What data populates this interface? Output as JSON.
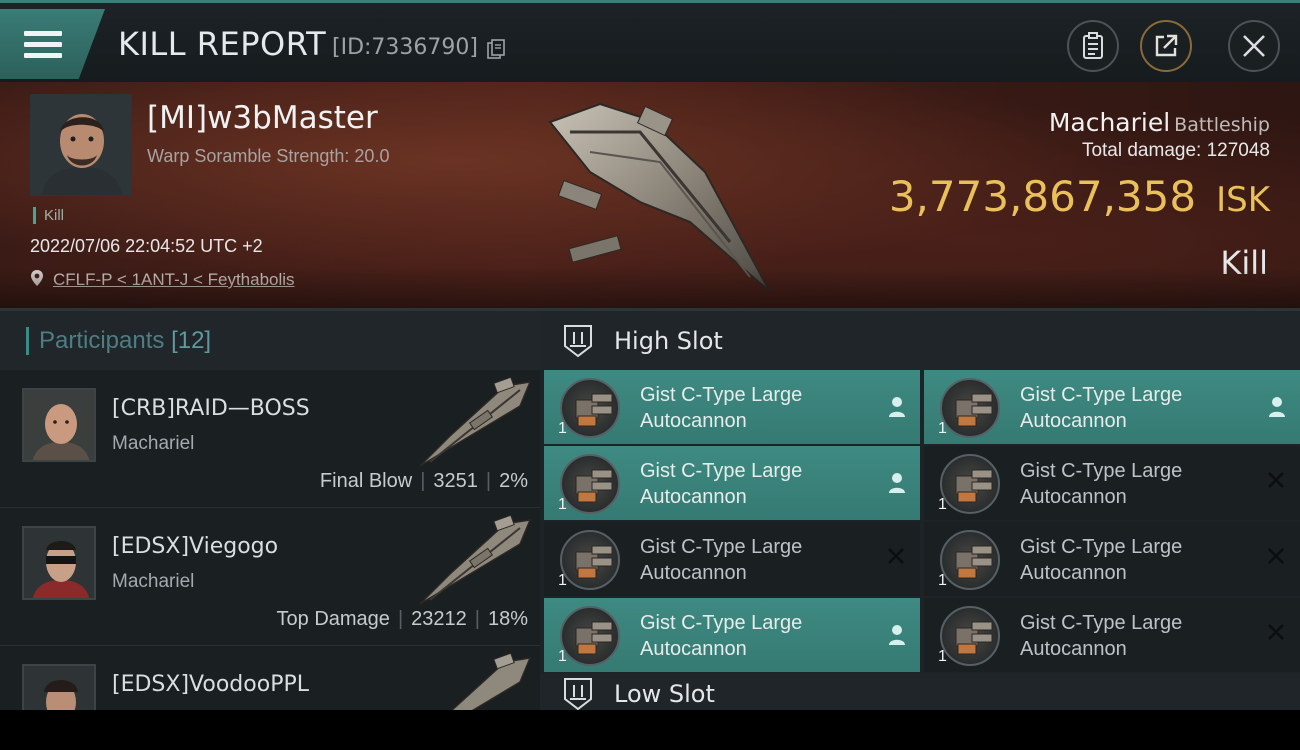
{
  "header": {
    "title": "KILL REPORT",
    "report_id": "[ID:7336790]",
    "icons": [
      "menu-icon",
      "copy-icon",
      "clipboard-icon",
      "share-icon",
      "close-icon"
    ]
  },
  "victim": {
    "name": "[MI]w3bMaster",
    "subtitle": "Warp Soramble Strength: 20.0",
    "kill_tag": "Kill",
    "timestamp": "2022/07/06 22:04:52 UTC +2",
    "location": "CFLF-P < 1ANT-J < Feythabolis",
    "ship_name": "Machariel",
    "ship_class": "Battleship",
    "total_damage_label": "Total damage:",
    "total_damage": "127048",
    "isk_value": "3,773,867,358",
    "isk_unit": "ISK",
    "result": "Kill"
  },
  "participants": {
    "title": "Participants",
    "count": "[12]",
    "rows": [
      {
        "name": "[CRB]RAID—BOSS",
        "ship": "Machariel",
        "role": "Final Blow",
        "damage": "3251",
        "percent": "2%"
      },
      {
        "name": "[EDSX]Viegogo",
        "ship": "Machariel",
        "role": "Top Damage",
        "damage": "23212",
        "percent": "18%"
      },
      {
        "name": "[EDSX]VoodooPPL",
        "ship": "",
        "role": "",
        "damage": "",
        "percent": ""
      }
    ]
  },
  "slots": {
    "high_title": "High Slot",
    "low_title": "Low Slot",
    "modules": [
      {
        "line1": "Gist C-Type Large",
        "line2": "Autocannon",
        "qty": "1",
        "state": "dropped"
      },
      {
        "line1": "Gist C-Type Large",
        "line2": "Autocannon",
        "qty": "1",
        "state": "dropped"
      },
      {
        "line1": "Gist C-Type Large",
        "line2": "Autocannon",
        "qty": "1",
        "state": "dropped"
      },
      {
        "line1": "Gist C-Type Large",
        "line2": "Autocannon",
        "qty": "1",
        "state": "destroyed"
      },
      {
        "line1": "Gist C-Type Large",
        "line2": "Autocannon",
        "qty": "1",
        "state": "destroyed"
      },
      {
        "line1": "Gist C-Type Large",
        "line2": "Autocannon",
        "qty": "1",
        "state": "destroyed"
      },
      {
        "line1": "Gist C-Type Large",
        "line2": "Autocannon",
        "qty": "1",
        "state": "dropped"
      },
      {
        "line1": "Gist C-Type Large",
        "line2": "Autocannon",
        "qty": "1",
        "state": "destroyed"
      }
    ]
  },
  "colors": {
    "accent_teal": "#3e8a82",
    "isk_gold": "#e9c05a"
  }
}
